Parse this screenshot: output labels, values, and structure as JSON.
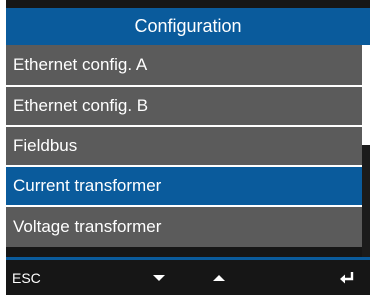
{
  "header": {
    "title": "Configuration"
  },
  "menu": {
    "items": [
      {
        "label": "Ethernet config. A",
        "selected": false
      },
      {
        "label": "Ethernet config. B",
        "selected": false
      },
      {
        "label": "Fieldbus",
        "selected": false
      },
      {
        "label": "Current transformer",
        "selected": true
      },
      {
        "label": "Voltage transformer",
        "selected": false
      }
    ]
  },
  "softkeys": {
    "esc_label": "ESC",
    "down_icon": "arrow-down-icon",
    "up_icon": "arrow-up-icon",
    "enter_icon": "enter-icon"
  },
  "colors": {
    "accent": "#0a5b9c",
    "item_bg": "#5b5b5b",
    "background": "#161616",
    "text": "#ffffff"
  }
}
